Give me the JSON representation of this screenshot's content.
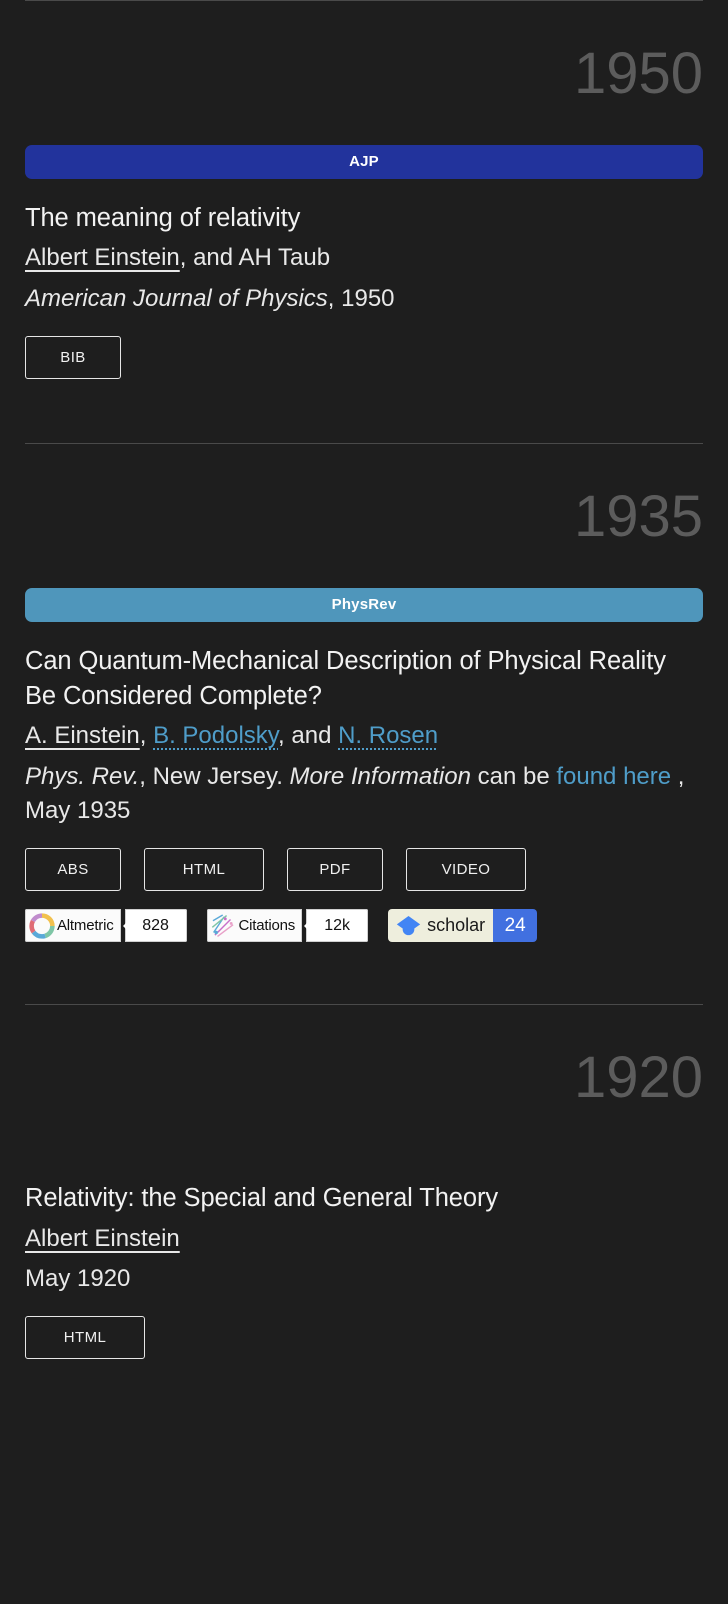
{
  "theme": {
    "background": "#1e1e1e",
    "text": "#e8e8e8",
    "year_color": "#5c5c5c",
    "link_color": "#4f9dc9",
    "divider": "#4a4a4a"
  },
  "entries": [
    {
      "year": "1950",
      "journal_badge": {
        "label": "AJP",
        "color": "#22339c"
      },
      "title": "The meaning of relativity",
      "authors": [
        {
          "text": "Albert Einstein",
          "style": "underline"
        },
        {
          "text": ", and ",
          "style": "plain"
        },
        {
          "text": "AH Taub",
          "style": "plain"
        }
      ],
      "venue_italic": "American Journal of Physics",
      "venue_rest": ", 1950",
      "buttons": [
        "BIB"
      ]
    },
    {
      "year": "1935",
      "journal_badge": {
        "label": "PhysRev",
        "color": "#4f96bb"
      },
      "title": "Can Quantum-Mechanical Description of Physical Reality Be Considered Complete?",
      "authors": [
        {
          "text": "A. Einstein",
          "style": "underline"
        },
        {
          "text": ", ",
          "style": "plain"
        },
        {
          "text": "B. Podolsky",
          "style": "link"
        },
        {
          "text": ", and ",
          "style": "plain"
        },
        {
          "text": "N. Rosen",
          "style": "link"
        }
      ],
      "venue_parts": {
        "italic1": "Phys. Rev.",
        "plain1": ", New Jersey. ",
        "italic2": "More Information",
        "plain2": " can be ",
        "link": "found here",
        "plain3": " , May 1935"
      },
      "buttons": [
        "ABS",
        "HTML",
        "PDF",
        "VIDEO"
      ],
      "metrics": [
        {
          "name": "altmetric",
          "label": "Altmetric",
          "value": "828"
        },
        {
          "name": "citations",
          "label": "Citations",
          "value": "12k"
        },
        {
          "name": "google-scholar",
          "label": "scholar",
          "value": "24"
        }
      ]
    },
    {
      "year": "1920",
      "title": "Relativity: the Special and General Theory",
      "authors": [
        {
          "text": "Albert Einstein",
          "style": "underline"
        }
      ],
      "venue_rest": "May 1920",
      "buttons": [
        "HTML"
      ]
    }
  ]
}
